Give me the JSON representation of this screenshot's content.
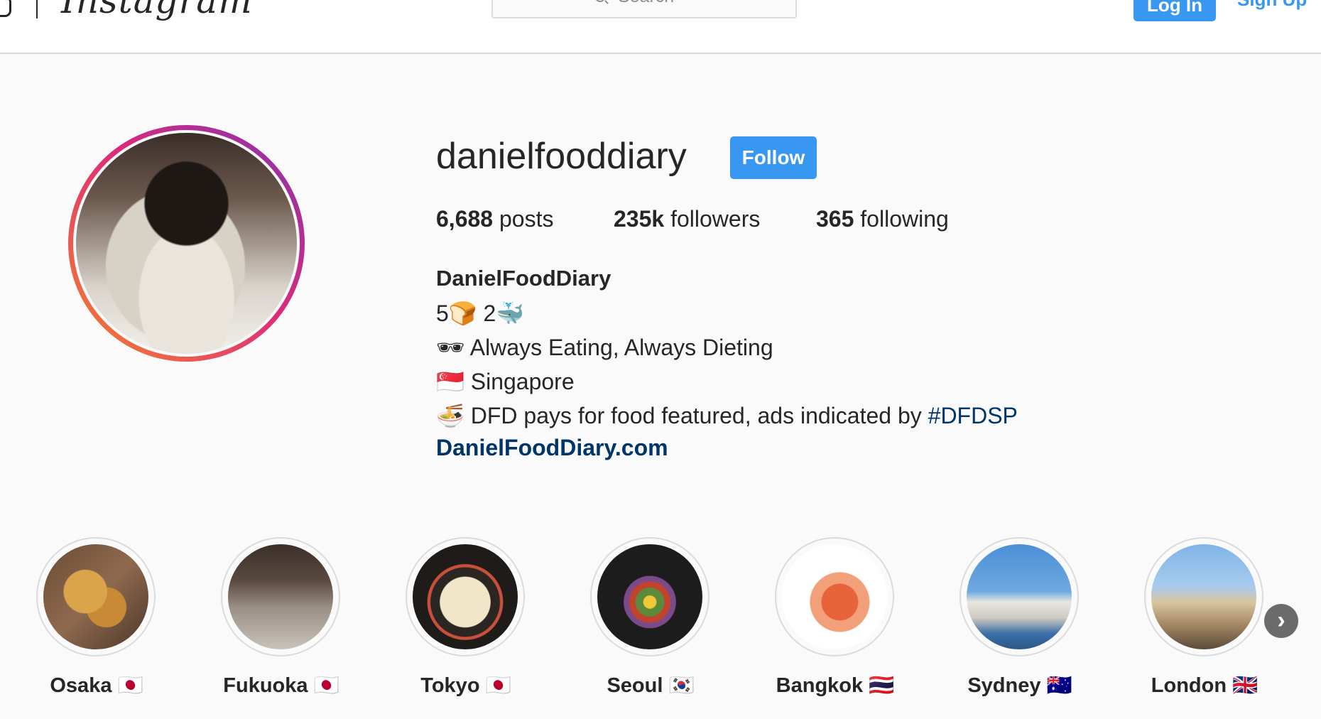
{
  "header": {
    "logo": "Instagram",
    "search_placeholder": "Search",
    "login_label": "Log In",
    "signup_label": "Sign Up"
  },
  "profile": {
    "username": "danielfooddiary",
    "follow_label": "Follow",
    "stats": {
      "posts_count": "6,688",
      "posts_label": "posts",
      "followers_count": "235k",
      "followers_label": "followers",
      "following_count": "365",
      "following_label": "following"
    },
    "bio": {
      "name": "DanielFoodDiary",
      "line1": "5🍞 2🐳",
      "line2": "🕶  Always Eating, Always Dieting",
      "line3": "🇸🇬  Singapore",
      "line4_text": "🍜  DFD pays for food featured, ads indicated by ",
      "line4_hashtag": "#DFDSP",
      "website": "DanielFoodDiary.com"
    }
  },
  "highlights": [
    {
      "label": "Osaka 🇯🇵"
    },
    {
      "label": "Fukuoka 🇯🇵"
    },
    {
      "label": "Tokyo 🇯🇵"
    },
    {
      "label": "Seoul 🇰🇷"
    },
    {
      "label": "Bangkok 🇹🇭"
    },
    {
      "label": "Sydney 🇦🇺"
    },
    {
      "label": "London 🇬🇧"
    }
  ],
  "icons": {
    "app_glyph": "instagram-glyph-icon",
    "search": "search-icon",
    "next": "chevron-right-icon"
  },
  "colors": {
    "primary_blue": "#3897f0",
    "link_blue": "#003569",
    "border": "#dbdbdb"
  }
}
